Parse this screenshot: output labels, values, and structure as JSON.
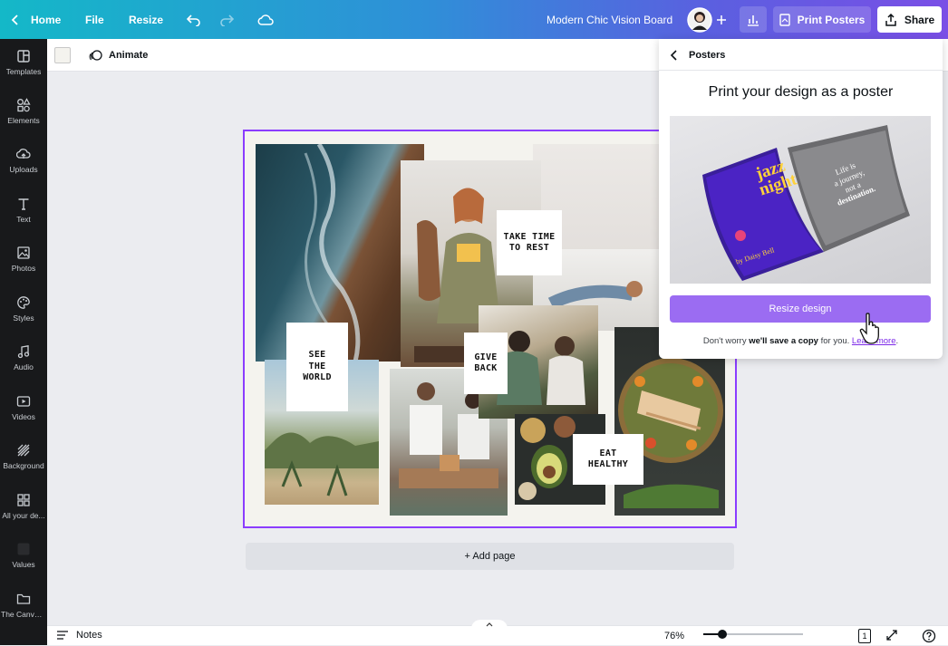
{
  "topbar": {
    "home_label": "Home",
    "file_label": "File",
    "resize_label": "Resize",
    "design_title": "Modern Chic Vision Board",
    "print_label": "Print Posters",
    "share_label": "Share",
    "gradient_start": "#14b8c8",
    "gradient_end": "#7a4fe6"
  },
  "sidebar": {
    "items": [
      {
        "label": "Templates",
        "icon": "templates-icon"
      },
      {
        "label": "Elements",
        "icon": "elements-icon"
      },
      {
        "label": "Uploads",
        "icon": "upload-cloud-icon"
      },
      {
        "label": "Text",
        "icon": "text-icon"
      },
      {
        "label": "Photos",
        "icon": "photos-icon"
      },
      {
        "label": "Styles",
        "icon": "styles-palette-icon"
      },
      {
        "label": "Audio",
        "icon": "music-note-icon"
      },
      {
        "label": "Videos",
        "icon": "video-icon"
      },
      {
        "label": "Background",
        "icon": "background-hatch-icon"
      },
      {
        "label": "All your de...",
        "icon": "all-designs-icon"
      },
      {
        "label": "Values",
        "icon": "values-app-icon"
      },
      {
        "label": "The Canva ...",
        "icon": "folder-icon"
      }
    ]
  },
  "subbar": {
    "animate_label": "Animate",
    "swatch_color": "#f4f3ee"
  },
  "canvas": {
    "notes": {
      "take_time": "TAKE TIME\nTO REST",
      "see_world": "SEE\nTHE\nWORLD",
      "give_back": "GIVE\nBACK",
      "eat_healthy": "EAT\nHEALTHY"
    },
    "add_page_label": "+ Add page"
  },
  "bottombar": {
    "notes_label": "Notes",
    "zoom_label": "76%",
    "zoom_fraction": 0.76,
    "page_count": "1"
  },
  "panel": {
    "back_label": "Posters",
    "title": "Print your design as a poster",
    "poster_left": {
      "line1": "jazz",
      "line2": "night",
      "byline": "by Daisy Bell"
    },
    "poster_right": {
      "line1": "Life is",
      "line2": "a journey,",
      "line3": "not a",
      "line4": "destination."
    },
    "resize_button": "Resize design",
    "dont_worry_prefix": "Don't worry",
    "dont_worry_bold": "we'll save a copy",
    "dont_worry_suffix": "for you.",
    "learn_more": "Learn more",
    "accent_color": "#9b6cf2"
  }
}
